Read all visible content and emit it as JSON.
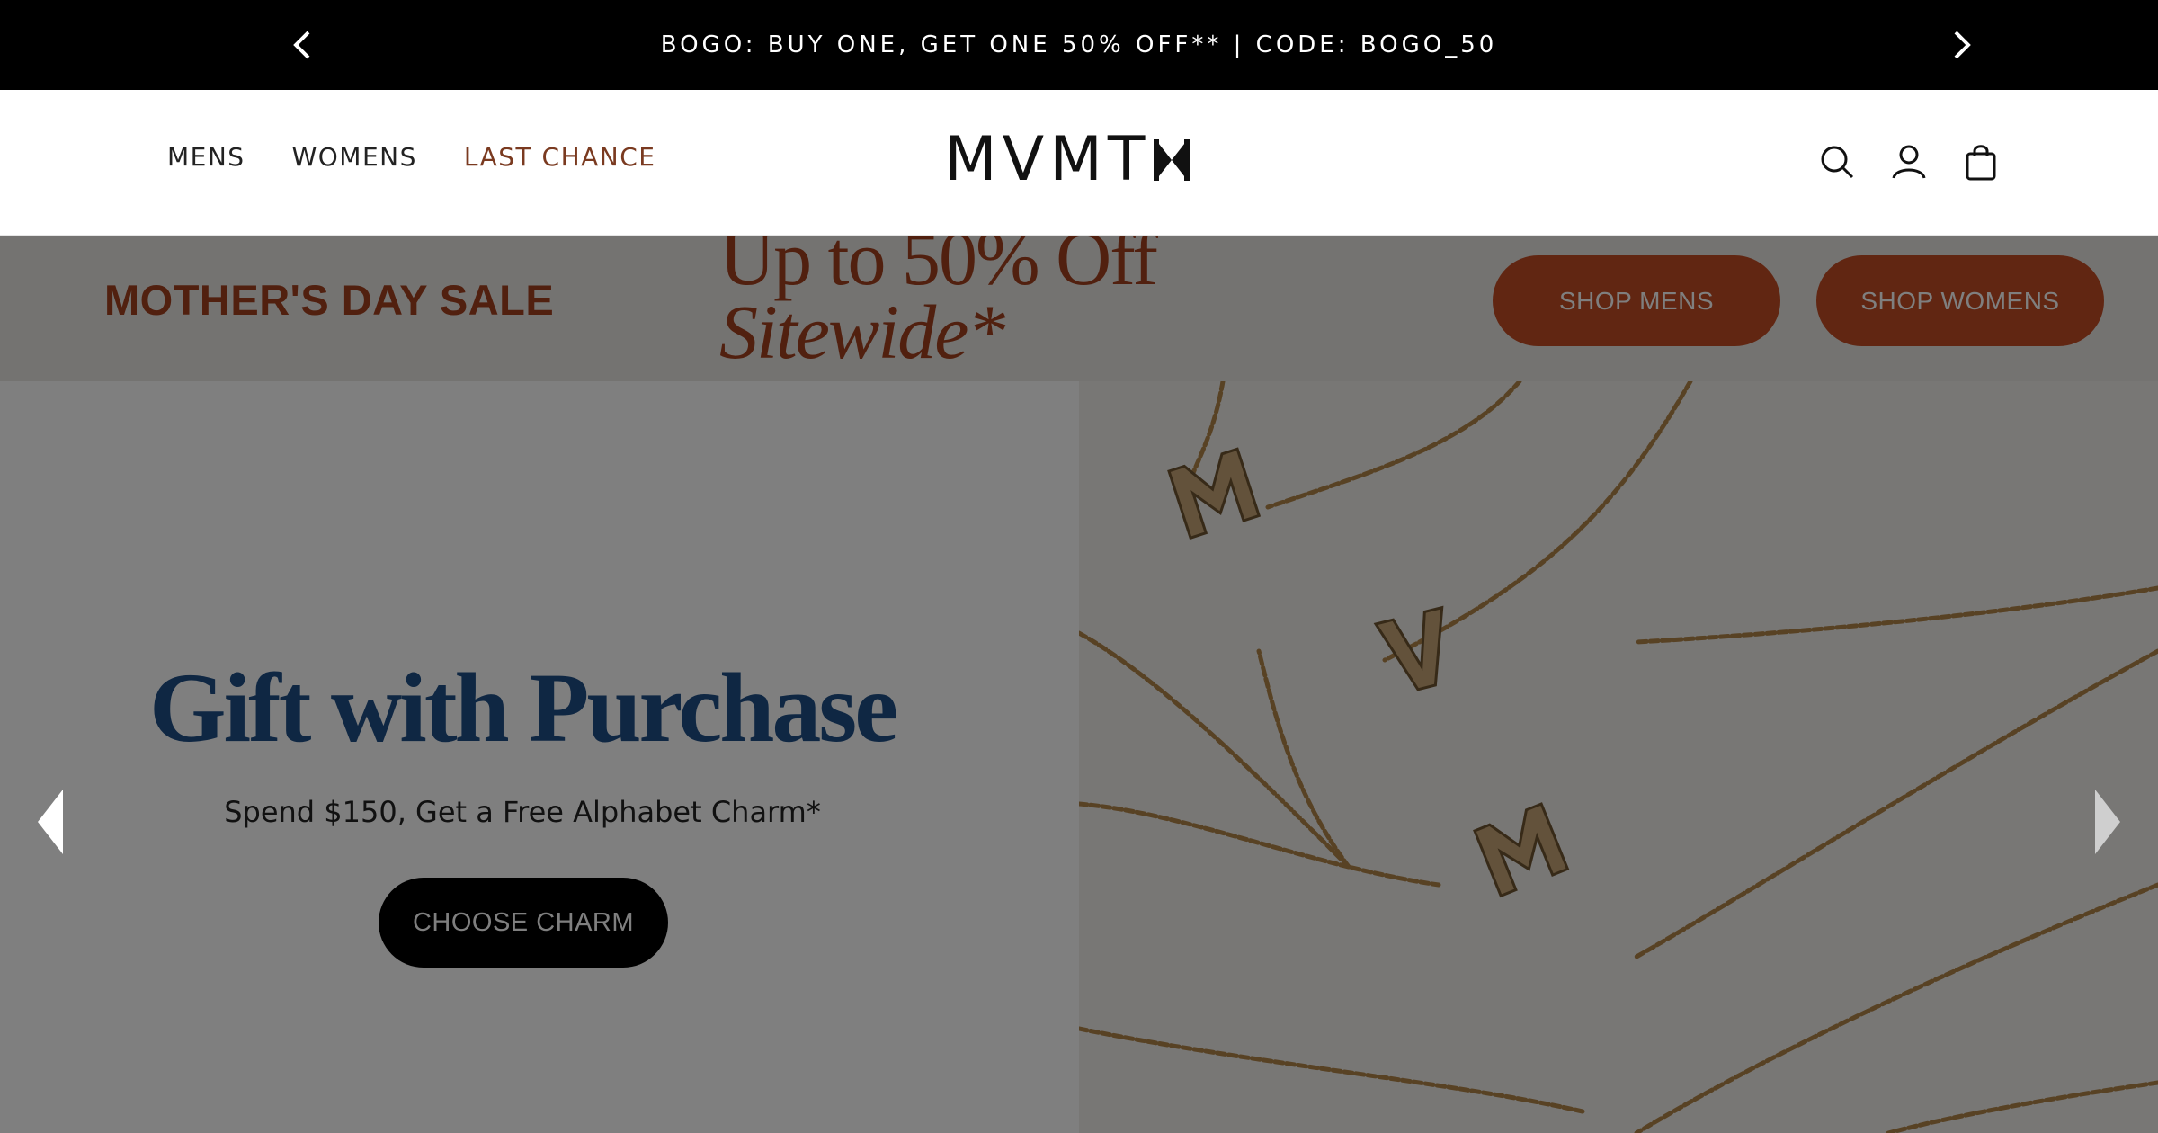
{
  "announcement": {
    "text": "BOGO: BUY ONE, GET ONE 50% OFF** | CODE: BOGO_50",
    "prev_icon": "chevron-left-icon",
    "next_icon": "chevron-right-icon"
  },
  "header": {
    "nav": [
      {
        "label": "MENS"
      },
      {
        "label": "WOMENS"
      },
      {
        "label": "LAST CHANCE"
      }
    ],
    "logo_text": "MVMT",
    "icons": [
      "search-icon",
      "account-icon",
      "cart-icon"
    ]
  },
  "promo": {
    "label": "MOTHER'S DAY SALE",
    "headline_line1": "Up to 50% Off",
    "headline_line2": "Sitewide*",
    "shop_mens": "SHOP MENS",
    "shop_womens": "SHOP WOMENS"
  },
  "hero": {
    "title": "Gift with Purchase",
    "subtitle": "Spend $150, Get a Free Alphabet Charm*",
    "cta": "CHOOSE CHARM",
    "image_letters": [
      "M",
      "V",
      "M"
    ]
  },
  "colors": {
    "accent": "#c24d24",
    "promo_text": "#a2401e",
    "hero_title": "#1f4e86",
    "announcement_bg": "#000000"
  }
}
